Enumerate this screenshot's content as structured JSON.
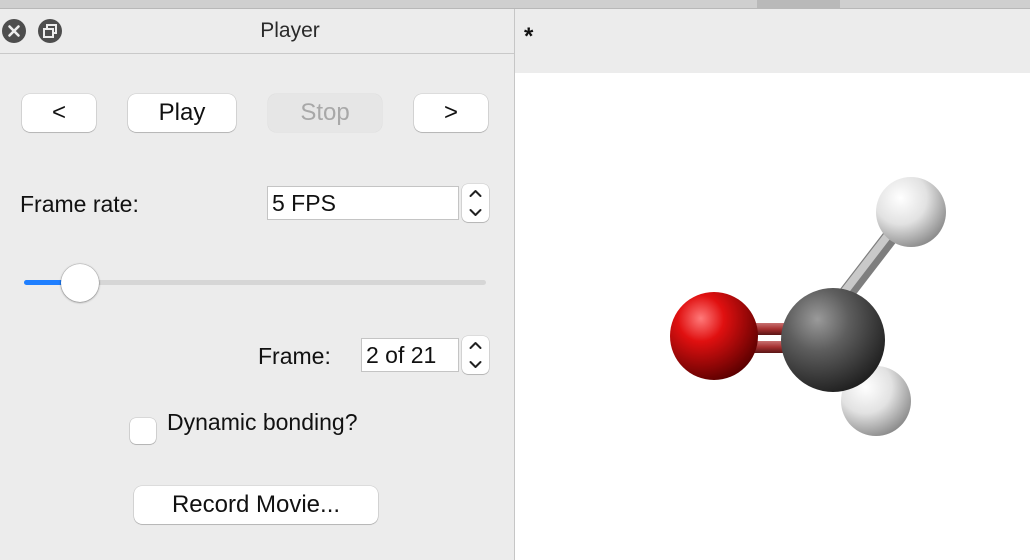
{
  "window": {
    "title": "Player"
  },
  "controls": {
    "prev_label": "<",
    "play_label": "Play",
    "stop_label": "Stop",
    "next_label": ">"
  },
  "frame_rate": {
    "label": "Frame rate:",
    "value": "5 FPS",
    "slider_fraction": 0.09
  },
  "frame": {
    "label": "Frame:",
    "value": "2 of 21"
  },
  "dynamic_bonding": {
    "label": "Dynamic bonding?",
    "checked": false
  },
  "record_button": {
    "label": "Record Movie..."
  },
  "viewer": {
    "header_mark": "*"
  },
  "colors": {
    "accent": "#1f7fff",
    "oxygen": "#d10a0a",
    "carbon": "#555555",
    "hydrogen": "#dcdcdc"
  },
  "icons": {
    "close": "close-icon",
    "float": "float-window-icon",
    "stepper_up": "chevron-up-icon",
    "stepper_down": "chevron-down-icon"
  }
}
